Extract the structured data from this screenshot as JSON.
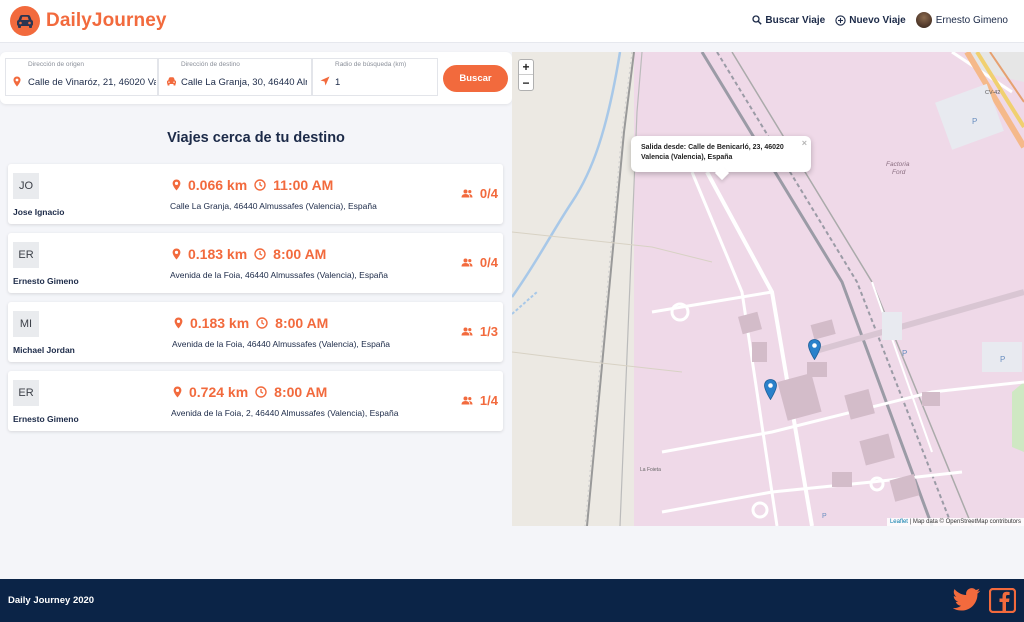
{
  "app": {
    "name": "DailyJourney"
  },
  "nav": {
    "search_label": "Buscar Viaje",
    "new_trip_label": "Nuevo Viaje",
    "user_name": "Ernesto Gimeno"
  },
  "search": {
    "origin_label": "Dirección de origen",
    "origin_value": "Calle de Vinaróz, 21, 46020 Va",
    "destination_label": "Dirección de destino",
    "destination_value": "Calle La Granja, 30, 46440 Alr",
    "radius_label": "Radio de búsqueda (km)",
    "radius_value": "1",
    "button_label": "Buscar"
  },
  "results": {
    "title": "Viajes cerca de tu destino",
    "trips": [
      {
        "initials": "JO",
        "driver": "Jose Ignacio",
        "distance": "0.066 km",
        "time": "11:00 AM",
        "address": "Calle La Granja, 46440 Almussafes (Valencia), España",
        "seats": "0/4"
      },
      {
        "initials": "ER",
        "driver": "Ernesto Gimeno",
        "distance": "0.183 km",
        "time": "8:00 AM",
        "address": "Avenida de la Foia, 46440 Almussafes (Valencia), España",
        "seats": "0/4"
      },
      {
        "initials": "MI",
        "driver": "Michael Jordan",
        "distance": "0.183 km",
        "time": "8:00 AM",
        "address": "Avenida de la Foia, 46440 Almussafes (Valencia), España",
        "seats": "1/3"
      },
      {
        "initials": "ER",
        "driver": "Ernesto Gimeno",
        "distance": "0.724 km",
        "time": "8:00 AM",
        "address": "Avenida de la Foia, 2, 46440 Almussafes (Valencia), España",
        "seats": "1/4"
      }
    ]
  },
  "map": {
    "zoom_in": "+",
    "zoom_out": "−",
    "popup_text": "Salida desde: Calle de Benicarló, 23, 46020 Valencia (Valencia), España",
    "popup_close": "×",
    "attribution_leaflet": "Leaflet",
    "attribution_rest": " | Map data © OpenStreetMap contributors",
    "labels": {
      "factoria": "Factoria",
      "ford": "Ford",
      "cv42": "CV-42",
      "la_foieta": "La Foieta",
      "p": "P"
    }
  },
  "footer": {
    "text": "Daily Journey 2020"
  },
  "colors": {
    "accent": "#f26a3d",
    "navy": "#0b2447",
    "text": "#1c2a48",
    "map_pink": "#f0dbe9",
    "marker_blue": "#2a81cb"
  },
  "icons": [
    "car-icon",
    "search-icon",
    "plus-circle-icon",
    "map-pin-icon",
    "location-arrow-icon",
    "clock-icon",
    "users-icon",
    "twitter-icon",
    "facebook-icon",
    "map-marker-icon"
  ]
}
